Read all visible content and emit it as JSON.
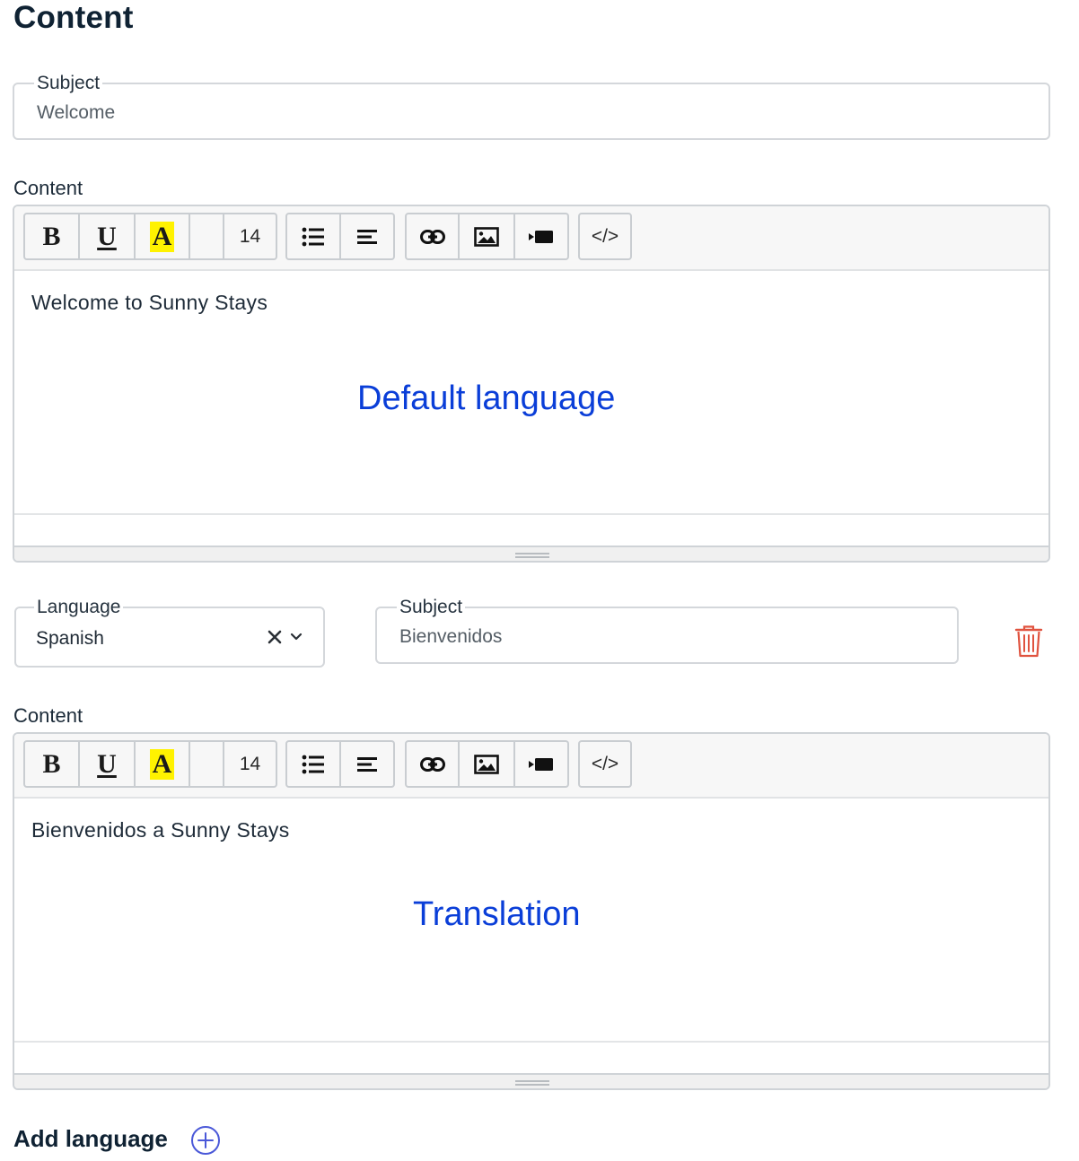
{
  "page": {
    "title": "Content"
  },
  "default_language": {
    "subject": {
      "label": "Subject",
      "value": "Welcome"
    },
    "content": {
      "label": "Content",
      "body_text": "Welcome to Sunny Stays",
      "annotation": "Default language"
    }
  },
  "toolbar": {
    "bold": "B",
    "underline": "U",
    "highlight": "A",
    "font_size": "14",
    "icons": [
      "bold-icon",
      "underline-icon",
      "highlight-icon",
      "color-icon",
      "font-size",
      "bulleted-list-icon",
      "align-icon",
      "link-icon",
      "image-icon",
      "video-icon",
      "code-icon"
    ],
    "code_label": "</>",
    "highlight_color": "#fff200"
  },
  "translation": {
    "language": {
      "label": "Language",
      "value": "Spanish"
    },
    "subject": {
      "label": "Subject",
      "value": "Bienvenidos"
    },
    "content": {
      "label": "Content",
      "body_text": "Bienvenidos a Sunny Stays",
      "annotation": "Translation"
    },
    "delete_icon": "trash-icon",
    "delete_color": "#e0533f"
  },
  "actions": {
    "add_language": "Add language",
    "add_icon": "plus-circle-icon",
    "accent_color": "#4a58d8"
  },
  "annotation_color": "#0a3ed8"
}
